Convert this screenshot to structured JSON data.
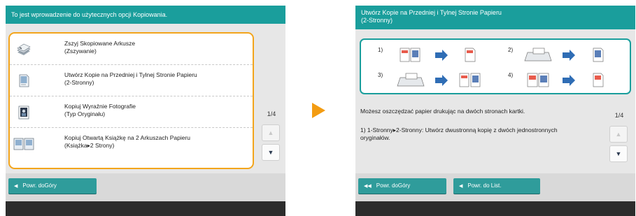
{
  "left_screen": {
    "title": "To jest wprowadzenie do użytecznych opcji Kopiowania.",
    "items": [
      {
        "label_line1": "Zszyj Skopiowane Arkusze",
        "label_line2": "(Zszywanie)"
      },
      {
        "label_line1": "Utwórz Kopie na Przedniej i Tylnej Stronie Papieru",
        "label_line2": "(2-Stronny)"
      },
      {
        "label_line1": "Kopiuj Wyraźnie Fotografie",
        "label_line2": "(Typ Oryginału)"
      },
      {
        "label_line1": "Kopiuj Otwartą Książkę na 2 Arkuszach Papieru",
        "label_line2": "(Książka▸2 Strony)"
      }
    ],
    "page_indicator": "1/4",
    "back_button": "Powr. doGóry"
  },
  "right_screen": {
    "title_line1": "Utwórz Kopie na Przedniej i Tylnej Stronie Papieru",
    "title_line2": "(2-Stronny)",
    "diagram_labels": [
      "1)",
      "2)",
      "3)",
      "4)"
    ],
    "description_line1": "Możesz oszczędzać papier drukując na dwóch stronach kartki.",
    "description_line2": "1) 1-Stronny▸2-Stronny: Utwórz dwustronną kopię z dwóch jednostronnych oryginałów.",
    "page_indicator": "1/4",
    "top_button": "Powr. doGóry",
    "list_button": "Powr. do List."
  },
  "colors": {
    "title_bar": "#1a9e9c",
    "list_border": "#f3a51c",
    "arrow": "#f39c12",
    "button": "#2f9c9b"
  }
}
